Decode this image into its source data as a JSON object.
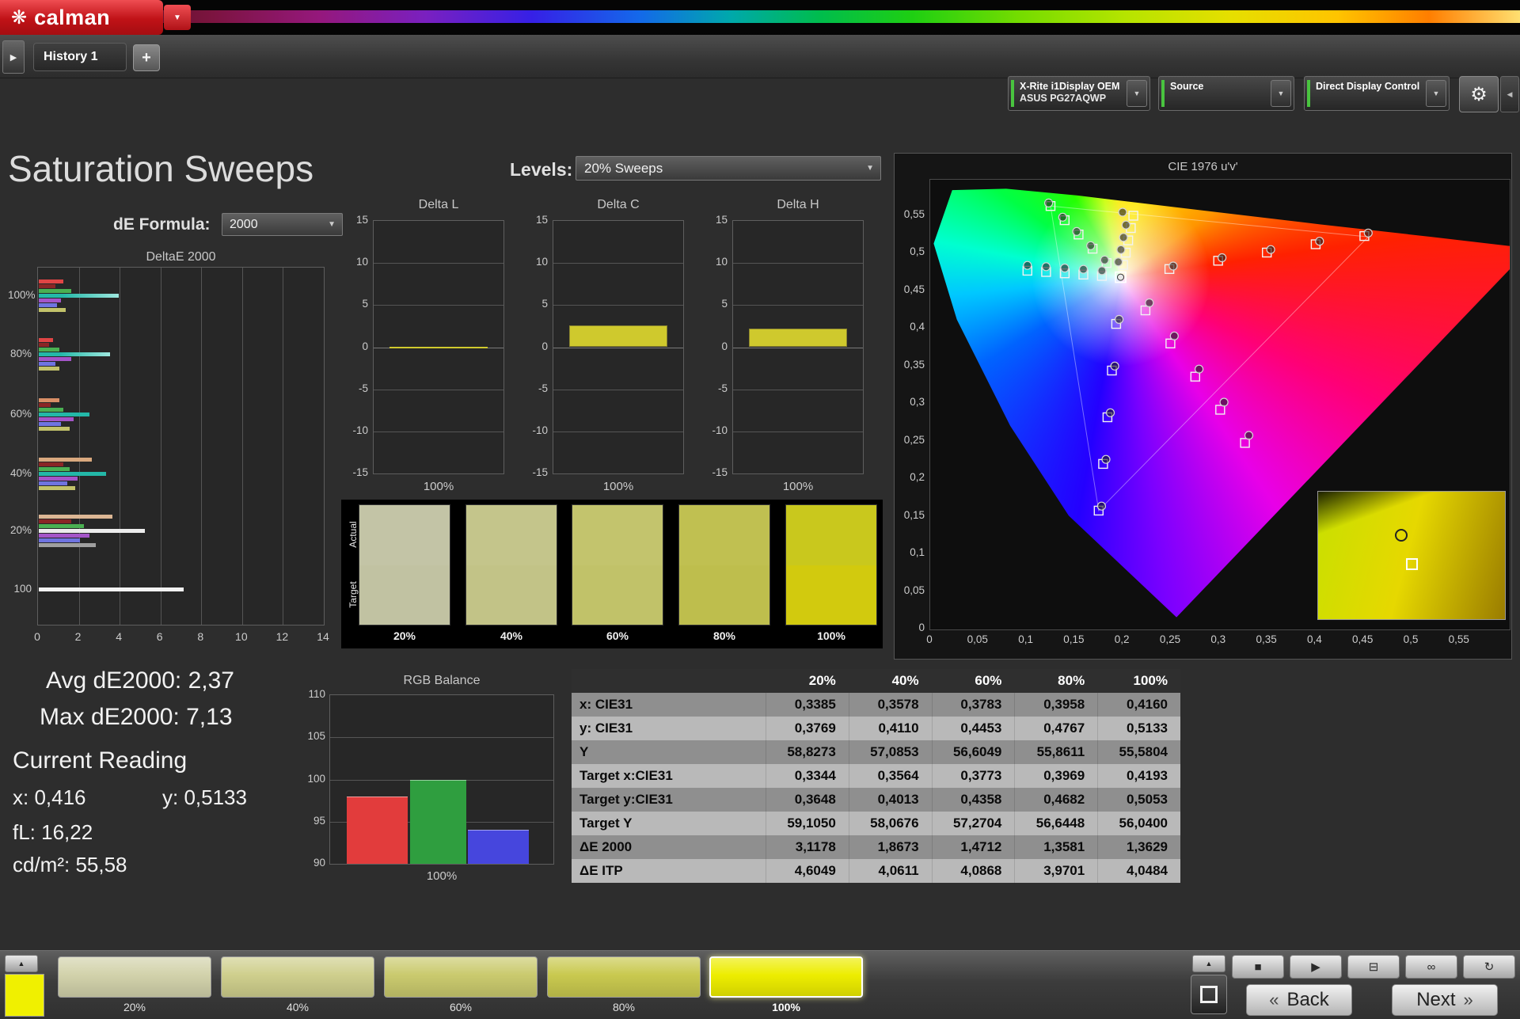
{
  "icons": {
    "flower": "❋",
    "dropdown": "▼",
    "collapse": "▶",
    "gear": "⚙",
    "panel_end": "◀",
    "up": "▲"
  },
  "app": {
    "logo_text": "calman",
    "tab_history": "History 1",
    "tab_add": "+",
    "workflow_buttons": [
      {
        "line1": "X-Rite i1Display OEM",
        "line2": "ASUS PG27AQWP"
      },
      {
        "line1": "Source",
        "line2": ""
      },
      {
        "line1": "Direct Display Control",
        "line2": ""
      }
    ]
  },
  "page": {
    "title": "Saturation Sweeps",
    "levels_label": "Levels:",
    "levels_value": "20% Sweeps",
    "de_formula_label": "dE Formula:",
    "de_formula_value": "2000"
  },
  "stats": {
    "avg": "Avg dE2000: 2,37",
    "max": "Max dE2000: 7,13",
    "current_reading": "Current Reading",
    "x": "x: 0,416",
    "y": "y: 0,5133",
    "fl": "fL: 16,22",
    "cdm2": "cd/m²: 55,58"
  },
  "chart_data": [
    {
      "id": "deltae2000",
      "type": "bar",
      "title": "DeltaE 2000",
      "orientation": "horizontal",
      "xlim": [
        0,
        14
      ],
      "x_ticks": [
        0,
        2,
        4,
        6,
        8,
        10,
        12,
        14
      ],
      "grid": true,
      "groups": [
        {
          "label": "100%",
          "bars": [
            {
              "color": "#e04545",
              "value": 1.2
            },
            {
              "color": "#8a2626",
              "value": 0.8
            },
            {
              "color": "#4ab052",
              "value": 1.6
            },
            {
              "color": "#23b8a8",
              "value": 3.9,
              "gradient": true
            },
            {
              "color": "#a455c8",
              "value": 1.1
            },
            {
              "color": "#6f74e0",
              "value": 0.9
            },
            {
              "color": "#c2c26a",
              "value": 1.3
            }
          ]
        },
        {
          "label": "80%",
          "bars": [
            {
              "color": "#e04545",
              "value": 0.7
            },
            {
              "color": "#8a2626",
              "value": 0.5
            },
            {
              "color": "#4ab052",
              "value": 1.0
            },
            {
              "color": "#23b8a8",
              "value": 3.5,
              "gradient": true
            },
            {
              "color": "#a455c8",
              "value": 1.6
            },
            {
              "color": "#6f74e0",
              "value": 0.8
            },
            {
              "color": "#c2c26a",
              "value": 1.0
            }
          ]
        },
        {
          "label": "60%",
          "bars": [
            {
              "color": "#d98f66",
              "value": 1.0
            },
            {
              "color": "#8a2626",
              "value": 0.6
            },
            {
              "color": "#4ab052",
              "value": 1.2
            },
            {
              "color": "#23b8a8",
              "value": 2.5
            },
            {
              "color": "#a455c8",
              "value": 1.7
            },
            {
              "color": "#6f74e0",
              "value": 1.1
            },
            {
              "color": "#c2c26a",
              "value": 1.5
            }
          ]
        },
        {
          "label": "40%",
          "bars": [
            {
              "color": "#d9a87e",
              "value": 2.6
            },
            {
              "color": "#8a2626",
              "value": 1.2
            },
            {
              "color": "#4ab052",
              "value": 1.5
            },
            {
              "color": "#23b8a8",
              "value": 3.3
            },
            {
              "color": "#a455c8",
              "value": 1.9
            },
            {
              "color": "#6f74e0",
              "value": 1.4
            },
            {
              "color": "#c2c26a",
              "value": 1.8
            }
          ]
        },
        {
          "label": "20%",
          "bars": [
            {
              "color": "#dcb694",
              "value": 3.6
            },
            {
              "color": "#8a2626",
              "value": 1.6
            },
            {
              "color": "#4ab052",
              "value": 2.2
            },
            {
              "color": "#ececec",
              "value": 5.2
            },
            {
              "color": "#a455c8",
              "value": 2.5
            },
            {
              "color": "#6f74e0",
              "value": 2.0
            },
            {
              "color": "#9f9f9f",
              "value": 2.8
            }
          ]
        },
        {
          "label": "100",
          "bars": [
            {
              "color": "#f2f2f2",
              "value": 7.1
            }
          ]
        }
      ]
    },
    {
      "id": "delta_l",
      "type": "bar",
      "title": "Delta L",
      "ylim": [
        -15,
        15
      ],
      "y_ticks": [
        15,
        10,
        5,
        0,
        -5,
        -10,
        -15
      ],
      "categories": [
        "100%"
      ],
      "values": [
        0.05
      ],
      "bar_color": "#cfc92d"
    },
    {
      "id": "delta_c",
      "type": "bar",
      "title": "Delta C",
      "ylim": [
        -15,
        15
      ],
      "y_ticks": [
        15,
        10,
        5,
        0,
        -5,
        -10,
        -15
      ],
      "categories": [
        "100%"
      ],
      "values": [
        2.6
      ],
      "bar_color": "#cfc92d"
    },
    {
      "id": "delta_h",
      "type": "bar",
      "title": "Delta H",
      "ylim": [
        -15,
        15
      ],
      "y_ticks": [
        15,
        10,
        5,
        0,
        -5,
        -10,
        -15
      ],
      "categories": [
        "100%"
      ],
      "values": [
        2.2
      ],
      "bar_color": "#cfc92d"
    },
    {
      "id": "rgb_balance",
      "type": "bar",
      "title": "RGB Balance",
      "ylim": [
        90,
        110
      ],
      "y_ticks": [
        110,
        105,
        100,
        95,
        90
      ],
      "categories": [
        "100%"
      ],
      "series": [
        {
          "name": "Red",
          "color": "#e23c3c",
          "value": 98
        },
        {
          "name": "Green",
          "color": "#2f9e3f",
          "value": 100
        },
        {
          "name": "Blue",
          "color": "#4646dd",
          "value": 94
        }
      ]
    },
    {
      "id": "cie",
      "type": "scatter",
      "title": "CIE 1976 u'v'",
      "xlim": [
        0,
        0.6
      ],
      "ylim": [
        0,
        0.6
      ],
      "x_ticks": [
        "0",
        "0,05",
        "0,1",
        "0,15",
        "0,2",
        "0,25",
        "0,3",
        "0,35",
        "0,4",
        "0,45",
        "0,5",
        "0,55"
      ],
      "y_ticks": [
        "0",
        "0,05",
        "0,1",
        "0,15",
        "0,2",
        "0,25",
        "0,3",
        "0,35",
        "0,4",
        "0,45",
        "0,5",
        "0,55"
      ],
      "white_point": [
        0.1978,
        0.4683
      ],
      "gamut": [
        [
          0.455,
          0.522
        ],
        [
          0.125,
          0.563
        ],
        [
          0.175,
          0.158
        ]
      ],
      "targets": [
        [
          0.2484,
          0.4792
        ],
        [
          0.2991,
          0.4902
        ],
        [
          0.3497,
          0.5011
        ],
        [
          0.4004,
          0.5121
        ],
        [
          0.451,
          0.523
        ],
        [
          0.1832,
          0.4872
        ],
        [
          0.1687,
          0.5062
        ],
        [
          0.1541,
          0.5251
        ],
        [
          0.1396,
          0.5441
        ],
        [
          0.125,
          0.563
        ],
        [
          0.1932,
          0.4062
        ],
        [
          0.1887,
          0.3442
        ],
        [
          0.1841,
          0.2821
        ],
        [
          0.1796,
          0.2201
        ],
        [
          0.175,
          0.158
        ],
        [
          0.1784,
          0.47
        ],
        [
          0.1591,
          0.4718
        ],
        [
          0.1397,
          0.4735
        ],
        [
          0.1204,
          0.4753
        ],
        [
          0.101,
          0.477
        ],
        [
          0.2236,
          0.4242
        ],
        [
          0.2495,
          0.3802
        ],
        [
          0.2753,
          0.3361
        ],
        [
          0.3012,
          0.2921
        ],
        [
          0.327,
          0.248
        ],
        [
          0.2004,
          0.4846
        ],
        [
          0.2031,
          0.501
        ],
        [
          0.2057,
          0.5173
        ],
        [
          0.2084,
          0.5337
        ],
        [
          0.211,
          0.55
        ]
      ],
      "measurements": [
        [
          0.2524,
          0.4832
        ],
        [
          0.3031,
          0.4942
        ],
        [
          0.3537,
          0.5051
        ],
        [
          0.4044,
          0.5161
        ],
        [
          0.455,
          0.527
        ],
        [
          0.1812,
          0.4912
        ],
        [
          0.1667,
          0.5102
        ],
        [
          0.1521,
          0.5291
        ],
        [
          0.1376,
          0.5481
        ],
        [
          0.123,
          0.567
        ],
        [
          0.1962,
          0.4122
        ],
        [
          0.1917,
          0.3502
        ],
        [
          0.1871,
          0.2881
        ],
        [
          0.1826,
          0.2261
        ],
        [
          0.178,
          0.164
        ],
        [
          0.1784,
          0.477
        ],
        [
          0.1591,
          0.4788
        ],
        [
          0.1397,
          0.4805
        ],
        [
          0.1204,
          0.4823
        ],
        [
          0.101,
          0.484
        ],
        [
          0.2276,
          0.4342
        ],
        [
          0.2535,
          0.3902
        ],
        [
          0.2793,
          0.3461
        ],
        [
          0.3052,
          0.3021
        ],
        [
          0.331,
          0.258
        ],
        [
          0.1954,
          0.4886
        ],
        [
          0.1981,
          0.505
        ],
        [
          0.2007,
          0.5213
        ],
        [
          0.2034,
          0.5377
        ],
        [
          0.1998,
          0.5547
        ]
      ]
    }
  ],
  "table": {
    "columns": [
      "20%",
      "40%",
      "60%",
      "80%",
      "100%"
    ],
    "rows": [
      {
        "label": "x: CIE31",
        "values": [
          "0,3385",
          "0,3578",
          "0,3783",
          "0,3958",
          "0,4160"
        ]
      },
      {
        "label": "y: CIE31",
        "values": [
          "0,3769",
          "0,4110",
          "0,4453",
          "0,4767",
          "0,5133"
        ]
      },
      {
        "label": "Y",
        "values": [
          "58,8273",
          "57,0853",
          "56,6049",
          "55,8611",
          "55,5804"
        ]
      },
      {
        "label": "Target x:CIE31",
        "values": [
          "0,3344",
          "0,3564",
          "0,3773",
          "0,3969",
          "0,4193"
        ]
      },
      {
        "label": "Target y:CIE31",
        "values": [
          "0,3648",
          "0,4013",
          "0,4358",
          "0,4682",
          "0,5053"
        ]
      },
      {
        "label": "Target Y",
        "values": [
          "59,1050",
          "58,0676",
          "57,2704",
          "56,6448",
          "56,0400"
        ]
      },
      {
        "label": "ΔE 2000",
        "values": [
          "3,1178",
          "1,8673",
          "1,4712",
          "1,3581",
          "1,3629"
        ]
      },
      {
        "label": "ΔE ITP",
        "values": [
          "4,6049",
          "4,0611",
          "4,0868",
          "3,9701",
          "4,0484"
        ]
      }
    ]
  },
  "swatches": {
    "actual_label": "Actual",
    "target_label": "Target",
    "items": [
      {
        "label": "20%",
        "actual": "#c3c4a6",
        "target": "#c1c2a2"
      },
      {
        "label": "40%",
        "actual": "#c4c58b",
        "target": "#c2c387"
      },
      {
        "label": "60%",
        "actual": "#c3c46d",
        "target": "#c1c269"
      },
      {
        "label": "80%",
        "actual": "#c0c051",
        "target": "#bebe4d"
      },
      {
        "label": "100%",
        "actual": "#c9c81d",
        "target": "#d2ca0e"
      }
    ]
  },
  "toolbar": {
    "selected_color": "#f0f000",
    "swatches": [
      {
        "label": "20%",
        "color": "#d2d2ab",
        "selected": false
      },
      {
        "label": "40%",
        "color": "#cfcf8d",
        "selected": false
      },
      {
        "label": "60%",
        "color": "#caca6e",
        "selected": false
      },
      {
        "label": "80%",
        "color": "#c9c94f",
        "selected": false
      },
      {
        "label": "100%",
        "color": "#eded00",
        "selected": true
      }
    ],
    "media_icons": [
      "■",
      "▶",
      "⊟",
      "∞",
      "↻"
    ],
    "back_chevron": "«",
    "back_label": "Back",
    "next_label": "Next",
    "next_chevron": "»"
  }
}
